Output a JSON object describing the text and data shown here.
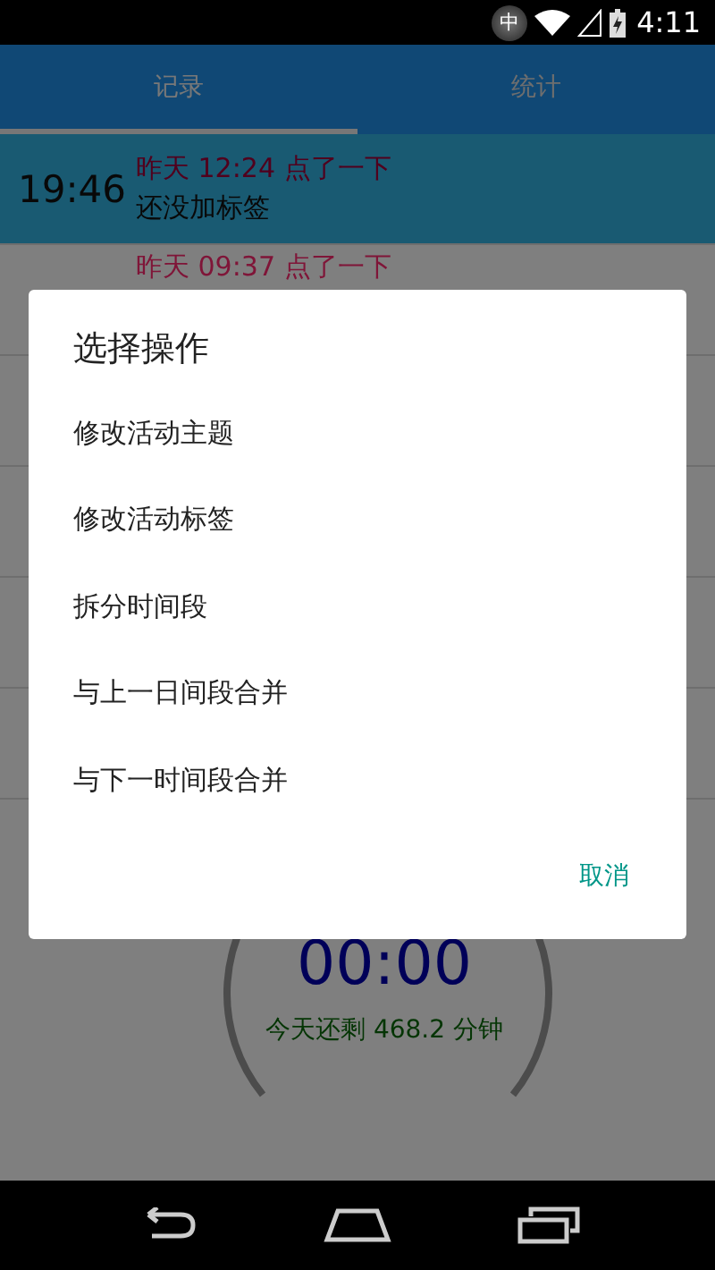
{
  "status_bar": {
    "input_method": "中",
    "time": "4:11"
  },
  "tabs": [
    {
      "label": "记录",
      "selected": true
    },
    {
      "label": "统计",
      "selected": false
    }
  ],
  "rows": [
    {
      "time": "19:46",
      "line1": "昨天 12:24 点了一下",
      "line2": "还没加标签",
      "selected": true
    },
    {
      "line1": "昨天 09:37 点了一下",
      "selected": false
    },
    {
      "selected": false
    },
    {
      "selected": false
    },
    {
      "selected": false
    },
    {
      "selected": false
    }
  ],
  "timer": {
    "time": "00:00",
    "remaining": "今天还剩 468.2 分钟"
  },
  "dialog": {
    "title": "选择操作",
    "items": [
      "修改活动主题",
      "修改活动标签",
      "拆分时间段",
      "与上一日间段合并",
      "与下一时间段合并"
    ],
    "cancel": "取消"
  }
}
